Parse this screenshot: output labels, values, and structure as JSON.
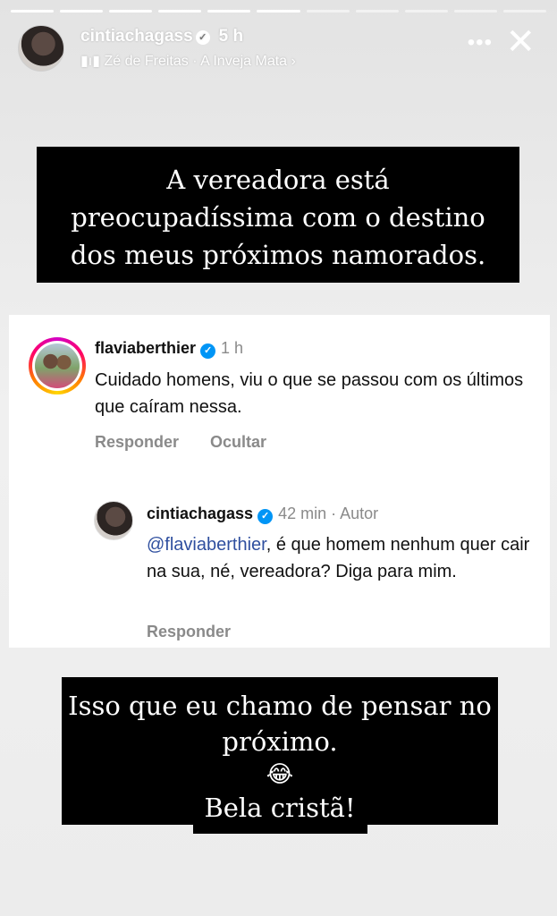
{
  "story": {
    "progress_total": 11,
    "progress_done": 6
  },
  "header": {
    "username": "cintiachagass",
    "verified_icon": "verified-badge-icon",
    "time": "5 h",
    "music_icon": "audio-bars-icon",
    "music": "Zé de Freitas · A Inveja Mata ›",
    "more_icon": "more-icon",
    "close_icon": "close-icon"
  },
  "caption_top": {
    "line1": "A vereadora está",
    "line2": "preocupadíssima com o destino",
    "line3": "dos meus próximos namorados."
  },
  "comment": {
    "username": "flaviaberthier",
    "time": "1 h",
    "text": "Cuidado homens, viu o que se passou com os últimos que caíram nessa.",
    "reply_label": "Responder",
    "hide_label": "Ocultar"
  },
  "reply": {
    "username": "cintiachagass",
    "meta": "42 min · Autor",
    "mention": "@flaviaberthier",
    "text": ", é que homem nenhum quer cair na sua, né, vereadora? Diga para mim.",
    "reply_label": "Responder"
  },
  "caption_bottom": {
    "line1": "Isso que eu chamo de pensar no",
    "line2": "próximo.",
    "emoji": "😂",
    "line3": "Bela cristã!"
  }
}
